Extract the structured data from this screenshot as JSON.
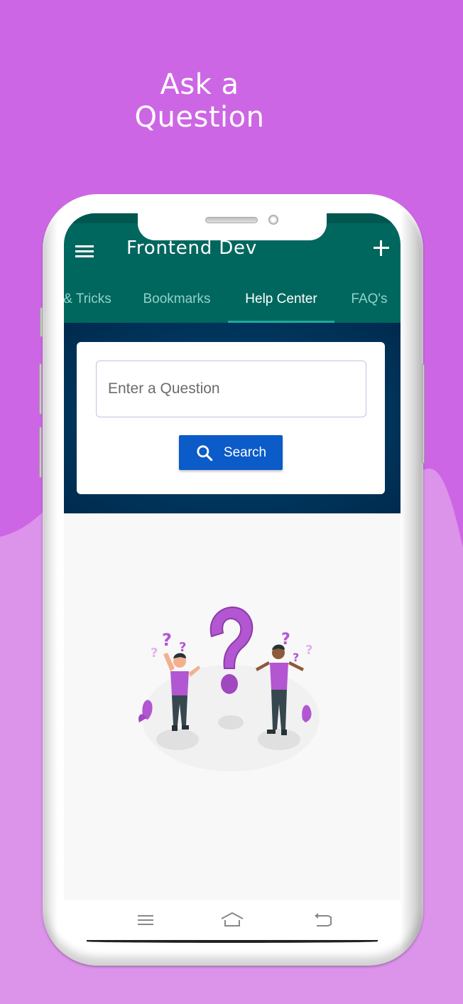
{
  "promo": {
    "title_line1": "Ask a",
    "title_line2": "Question"
  },
  "colors": {
    "background": "#cd66e4",
    "background_light": "#dc93ea",
    "appbar": "#00675f",
    "tab_indicator": "#1fa99a",
    "search_area": "#00375e",
    "search_button": "#0b5bc9",
    "illustration_accent": "#b256d1"
  },
  "app": {
    "title": "Frontend Dev",
    "menu_icon": "hamburger-menu-icon",
    "add_icon": "plus-icon"
  },
  "tabs": [
    {
      "label": "& Tricks",
      "active": false
    },
    {
      "label": "Bookmarks",
      "active": false
    },
    {
      "label": "Help Center",
      "active": true
    },
    {
      "label": "FAQ's",
      "active": false
    }
  ],
  "search": {
    "placeholder": "Enter a Question",
    "value": "",
    "button_label": "Search",
    "button_icon": "search-icon"
  },
  "illustration": {
    "description": "two confused people with question marks"
  },
  "navbar": {
    "items": [
      {
        "icon": "recent-apps-icon"
      },
      {
        "icon": "home-icon"
      },
      {
        "icon": "back-icon"
      }
    ]
  }
}
